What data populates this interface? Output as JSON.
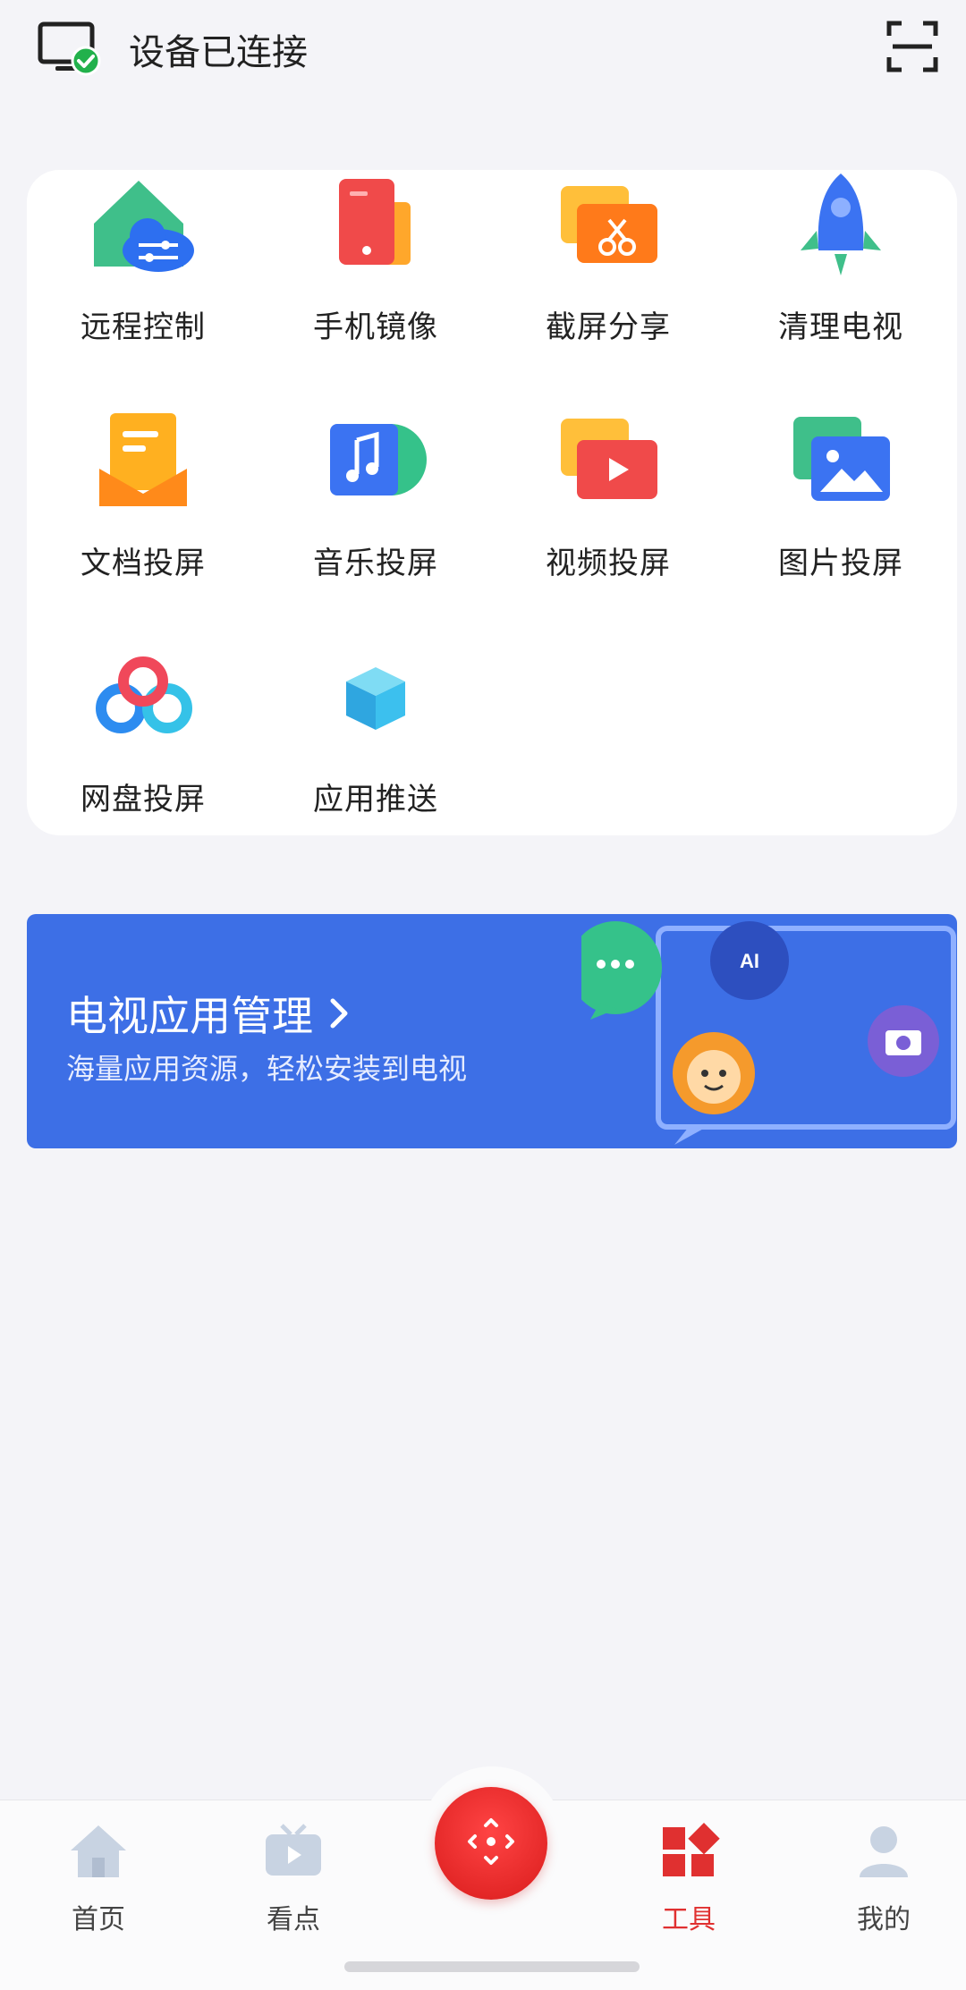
{
  "header": {
    "status_text": "设备已连接",
    "device_icon": "tv-connected-icon",
    "scan_icon": "scan-icon"
  },
  "tools": [
    {
      "label": "远程控制",
      "icon": "remote-control-icon"
    },
    {
      "label": "手机镜像",
      "icon": "phone-mirror-icon"
    },
    {
      "label": "截屏分享",
      "icon": "screenshot-share-icon"
    },
    {
      "label": "清理电视",
      "icon": "clean-tv-icon"
    },
    {
      "label": "文档投屏",
      "icon": "document-cast-icon"
    },
    {
      "label": "音乐投屏",
      "icon": "music-cast-icon"
    },
    {
      "label": "视频投屏",
      "icon": "video-cast-icon"
    },
    {
      "label": "图片投屏",
      "icon": "image-cast-icon"
    },
    {
      "label": "网盘投屏",
      "icon": "cloud-drive-cast-icon"
    },
    {
      "label": "应用推送",
      "icon": "app-push-icon"
    }
  ],
  "banner": {
    "title": "电视应用管理",
    "subtitle": "海量应用资源，轻松安装到电视",
    "chevron": "chevron-right-icon",
    "bubble_ai_text": "AI"
  },
  "bottom_nav": {
    "items": [
      {
        "label": "首页",
        "icon": "home-icon",
        "active": false
      },
      {
        "label": "看点",
        "icon": "tv-play-icon",
        "active": false
      },
      {
        "label": "工具",
        "icon": "tools-icon",
        "active": true
      },
      {
        "label": "我的",
        "icon": "profile-icon",
        "active": false
      }
    ],
    "center_icon": "remote-dpad-icon"
  },
  "colors": {
    "accent_red": "#e03030",
    "banner_blue": "#3d6fe6",
    "connected_green": "#22b14c"
  }
}
